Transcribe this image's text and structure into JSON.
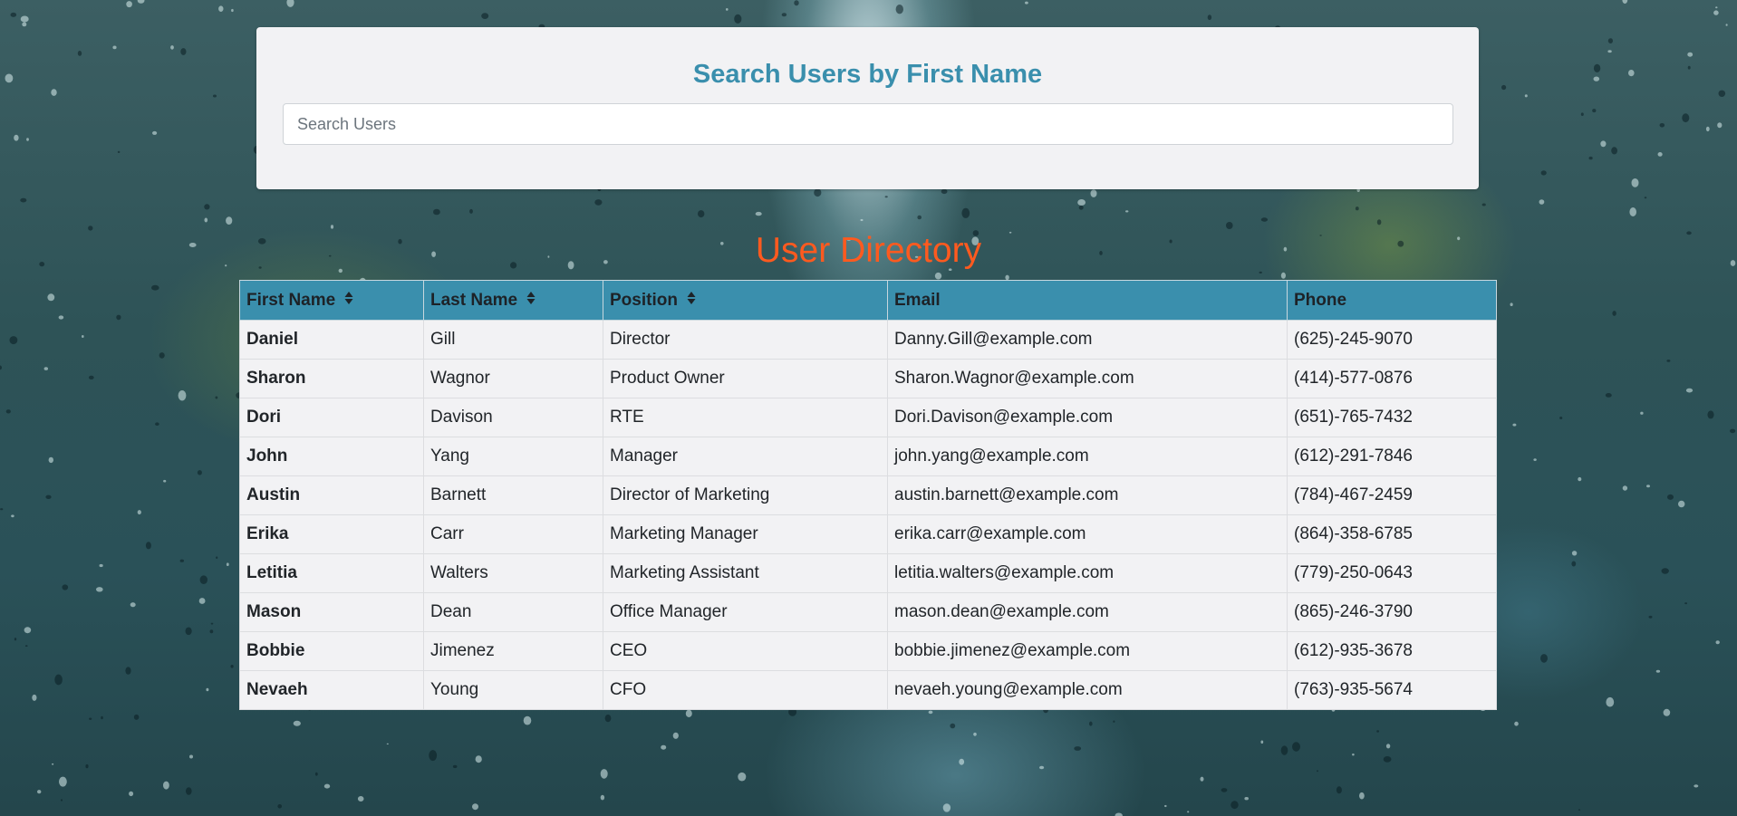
{
  "search": {
    "title": "Search Users by First Name",
    "placeholder": "Search Users",
    "value": ""
  },
  "directory": {
    "title": "User Directory"
  },
  "table": {
    "headers": [
      {
        "label": "First Name",
        "sortable": true,
        "icon": "sort-icon"
      },
      {
        "label": "Last Name",
        "sortable": true,
        "icon": "sort-icon"
      },
      {
        "label": "Position",
        "sortable": true,
        "icon": "sort-icon"
      },
      {
        "label": "Email",
        "sortable": false
      },
      {
        "label": "Phone",
        "sortable": false
      }
    ],
    "rows": [
      {
        "first": "Daniel",
        "last": "Gill",
        "position": "Director",
        "email": "Danny.Gill@example.com",
        "phone": "(625)-245-9070"
      },
      {
        "first": "Sharon",
        "last": "Wagnor",
        "position": "Product Owner",
        "email": "Sharon.Wagnor@example.com",
        "phone": "(414)-577-0876"
      },
      {
        "first": "Dori",
        "last": "Davison",
        "position": "RTE",
        "email": "Dori.Davison@example.com",
        "phone": "(651)-765-7432"
      },
      {
        "first": "John",
        "last": "Yang",
        "position": "Manager",
        "email": "john.yang@example.com",
        "phone": "(612)-291-7846"
      },
      {
        "first": "Austin",
        "last": "Barnett",
        "position": "Director of Marketing",
        "email": "austin.barnett@example.com",
        "phone": "(784)-467-2459"
      },
      {
        "first": "Erika",
        "last": "Carr",
        "position": "Marketing Manager",
        "email": "erika.carr@example.com",
        "phone": "(864)-358-6785"
      },
      {
        "first": "Letitia",
        "last": "Walters",
        "position": "Marketing Assistant",
        "email": "letitia.walters@example.com",
        "phone": "(779)-250-0643"
      },
      {
        "first": "Mason",
        "last": "Dean",
        "position": "Office Manager",
        "email": "mason.dean@example.com",
        "phone": "(865)-246-3790"
      },
      {
        "first": "Bobbie",
        "last": "Jimenez",
        "position": "CEO",
        "email": "bobbie.jimenez@example.com",
        "phone": "(612)-935-3678"
      },
      {
        "first": "Nevaeh",
        "last": "Young",
        "position": "CFO",
        "email": "nevaeh.young@example.com",
        "phone": "(763)-935-5674"
      }
    ]
  },
  "colors": {
    "accent": "#3a8fad",
    "directory_title": "#ff5a1f",
    "panel_bg": "#f2f2f4"
  }
}
